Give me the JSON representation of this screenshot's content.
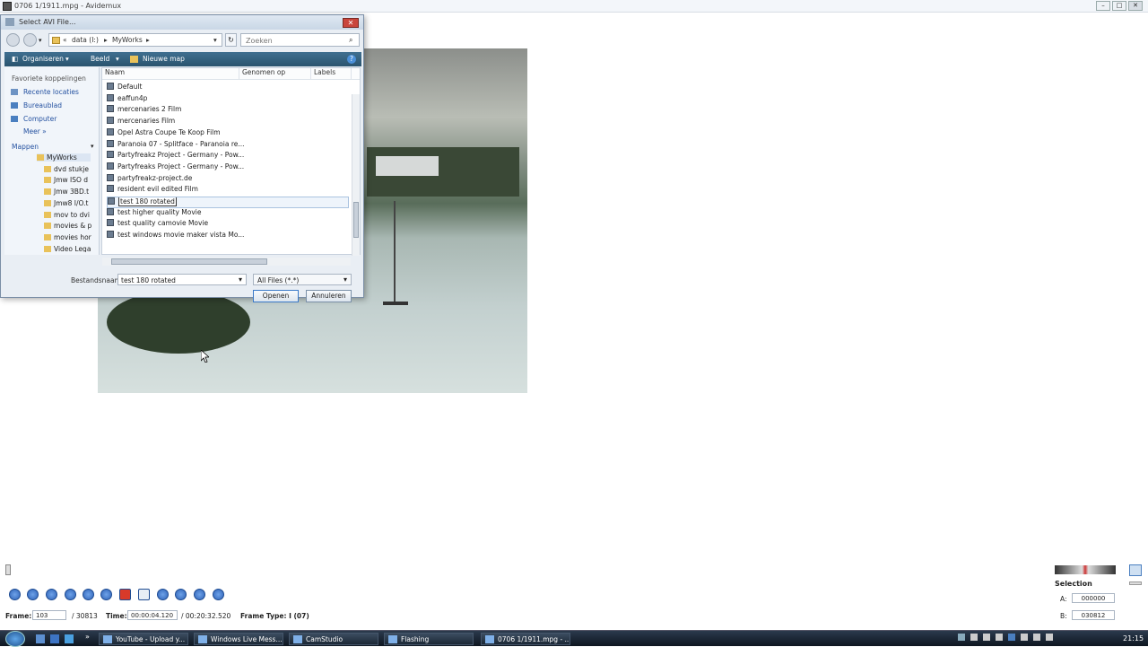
{
  "window": {
    "title": "0706 1/1911.mpg - Avidemux",
    "min": "–",
    "max": "□",
    "close": "✕"
  },
  "dialog": {
    "title": "Select AVI File...",
    "close": "✕",
    "address": [
      "«",
      "data (I:)",
      "▸",
      "MyWorks",
      "▸"
    ],
    "refresh": "↻",
    "search_placeholder": "Zoeken",
    "toolbar": {
      "organize": "Organiseren",
      "view": "Beeld",
      "new_folder": "Nieuwe map",
      "help": "?"
    },
    "left": {
      "heading": "Favoriete koppelingen",
      "favorites": [
        "Recente locaties",
        "Bureaublad",
        "Computer"
      ],
      "more": "Meer »",
      "folders_heading": "Mappen",
      "folders": [
        "MyWorks",
        "dvd stukje",
        "Jmw ISO d",
        "Jmw 3BD.t",
        "Jmw8 I/O.t",
        "mov to dvi",
        "movies & p",
        "movies hor",
        "Video Lega"
      ]
    },
    "columns": [
      "Naam",
      "Genomen op",
      "Labels"
    ],
    "files": [
      "Default",
      "eaffun4p",
      "mercenaries 2 Film",
      "mercenaries Film",
      "Opel Astra Coupe Te Koop Film",
      "Paranoia 07 - Splitface - Paranoia re...",
      "Partyfreakz Project - Germany - Pow...",
      "Partyfreaks Project - Germany - Pow...",
      "partyfreakz-project.de",
      "resident evil edited Film",
      "test 180 rotated",
      "test higher quality Movie",
      "test quality camovie Movie",
      "test windows movie maker vista Mo..."
    ],
    "selected_index": 10,
    "filename_label": "Bestandsnaam:",
    "filename_value": "test 180 rotated",
    "filter_value": "All Files (*.*)",
    "open_button": "Openen",
    "cancel_button": "Annuleren"
  },
  "status": {
    "frame_label": "Frame:",
    "frame_value": "103",
    "frame_total": "/ 30813",
    "time_label": "Time:",
    "time_value": "00:00:04.120",
    "time_total": "/ 00:20:32.520",
    "frame_type": "Frame Type: I (07)"
  },
  "selection": {
    "label": "Selection",
    "a_label": "A:",
    "a_value": "000000",
    "b_label": "B:",
    "b_value": "030812"
  },
  "taskbar": {
    "tasks": [
      "YouTube - Upload y...",
      "Windows Live Mess...",
      "CamStudio",
      "Flashing",
      "0706 1/1911.mpg - ..."
    ],
    "clock": "21:15"
  },
  "colors": {
    "accent": "#2f63b8",
    "toolbar": "#2a546f",
    "taskbar": "#0e1620"
  }
}
